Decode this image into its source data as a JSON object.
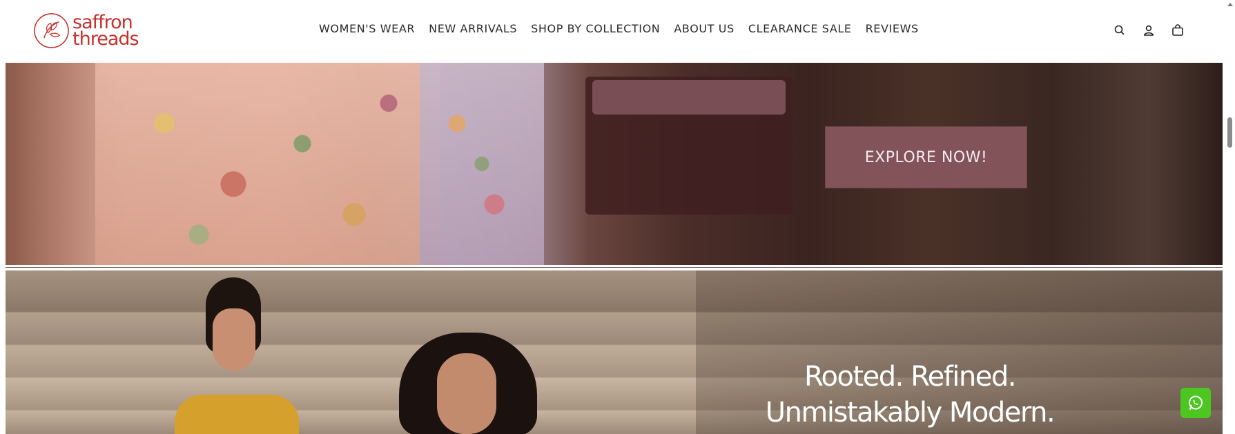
{
  "header": {
    "logo": {
      "line1": "saffron",
      "line2": "threads"
    },
    "nav": [
      {
        "label": "WOMEN'S WEAR"
      },
      {
        "label": "NEW ARRIVALS"
      },
      {
        "label": "SHOP BY COLLECTION"
      },
      {
        "label": "ABOUT US"
      },
      {
        "label": "CLEARANCE SALE"
      },
      {
        "label": "REVIEWS"
      }
    ],
    "icons": [
      "search-icon",
      "account-icon",
      "cart-icon"
    ]
  },
  "banner1": {
    "cta_label": "EXPLORE NOW!"
  },
  "banner2": {
    "tagline_line1": "Rooted. Refined.",
    "tagline_line2": "Unmistakably Modern."
  },
  "floating": {
    "whatsapp_icon": "whatsapp-icon"
  },
  "colors": {
    "brand": "#c9302c",
    "cta_bg": "#82545a",
    "whatsapp": "#4cc71f"
  }
}
